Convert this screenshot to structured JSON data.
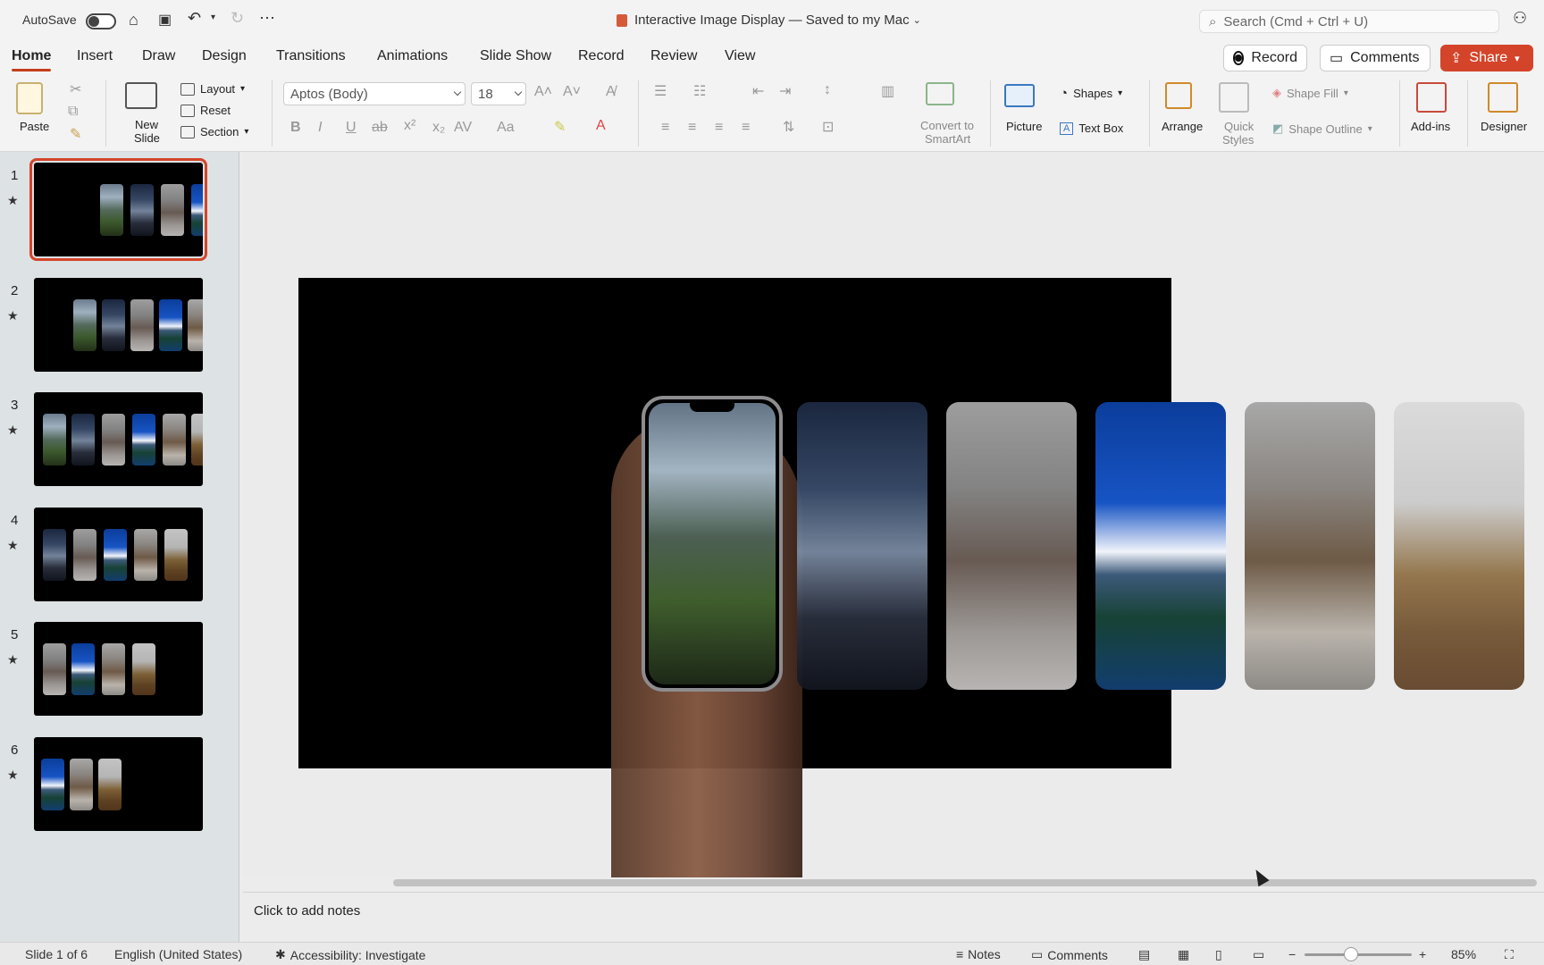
{
  "titlebar": {
    "autosave_label": "AutoSave",
    "doc_title": "Interactive Image Display — Saved to my Mac",
    "search_placeholder": "Search (Cmd + Ctrl + U)"
  },
  "tabs": [
    "Home",
    "Insert",
    "Draw",
    "Design",
    "Transitions",
    "Animations",
    "Slide Show",
    "Record",
    "Review",
    "View"
  ],
  "actions": {
    "record": "Record",
    "comments": "Comments",
    "share": "Share"
  },
  "ribbon": {
    "paste": "Paste",
    "new_slide_1": "New",
    "new_slide_2": "Slide",
    "layout": "Layout",
    "reset": "Reset",
    "section": "Section",
    "font_name": "Aptos (Body)",
    "font_size": "18",
    "convert_1": "Convert to",
    "convert_2": "SmartArt",
    "picture": "Picture",
    "shapes": "Shapes",
    "text_box": "Text Box",
    "arrange": "Arrange",
    "quick_styles_1": "Quick",
    "quick_styles_2": "Styles",
    "shape_fill": "Shape Fill",
    "shape_outline": "Shape Outline",
    "add_ins": "Add-ins",
    "designer": "Designer"
  },
  "thumbnails": [
    {
      "num": "1",
      "star": "★"
    },
    {
      "num": "2",
      "star": "★"
    },
    {
      "num": "3",
      "star": "★"
    },
    {
      "num": "4",
      "star": "★"
    },
    {
      "num": "5",
      "star": "★"
    },
    {
      "num": "6",
      "star": "★"
    }
  ],
  "notes_placeholder": "Click to add notes",
  "status": {
    "slide": "Slide 1 of 6",
    "language": "English (United States)",
    "accessibility": "Accessibility: Investigate",
    "notes": "Notes",
    "comments": "Comments",
    "zoom": "85%"
  },
  "colors": {
    "accent": "#d4442a",
    "slide_bg": "#000000"
  }
}
